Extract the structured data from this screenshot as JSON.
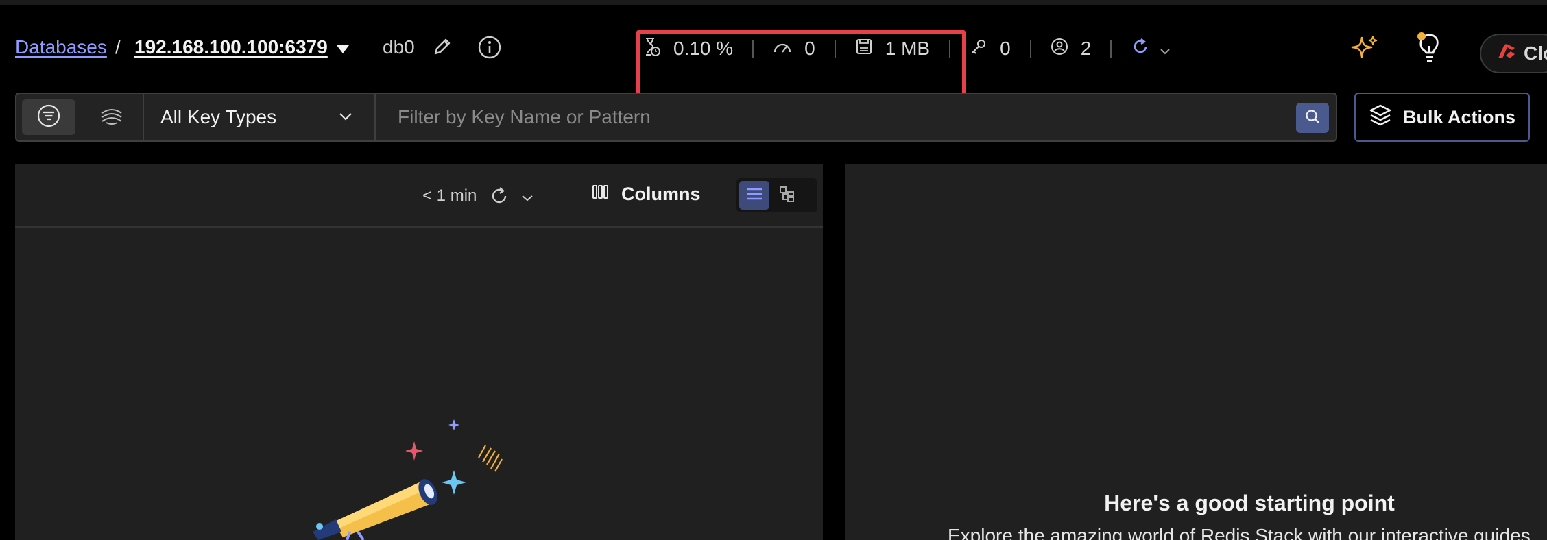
{
  "breadcrumb": {
    "databases_label": "Databases",
    "separator": "/",
    "host": "192.168.100.100:6379",
    "db_label": "db0"
  },
  "stats": {
    "cpu": "0.10 %",
    "ops": "0",
    "memory": "1 MB",
    "keys": "0",
    "clients": "2"
  },
  "header_actions": {
    "cloud_label": "Clo"
  },
  "filter": {
    "key_type_selected": "All Key Types",
    "search_placeholder": "Filter by Key Name or Pattern",
    "search_value": ""
  },
  "bulk_actions_label": "Bulk Actions",
  "list_header": {
    "last_refresh": "< 1 min",
    "columns_label": "Columns"
  },
  "right_panel": {
    "title": "Here's a good starting point",
    "subtitle": "Explore the amazing world of Redis Stack with our interactive guides"
  },
  "colors": {
    "accent": "#8f9bff",
    "highlight": "#e8404b",
    "redis_red": "#e8403a",
    "star_gold": "#f2b13a",
    "sparkle_pink": "#e8566a",
    "sparkle_blue": "#6cc6f0"
  },
  "icons": [
    "timer-icon",
    "gauge-icon",
    "memory-icon",
    "key-icon",
    "user-icon",
    "refresh-icon",
    "ai-sparkle-icon",
    "lightbulb-icon",
    "filter-icon",
    "stack-icon",
    "search-icon",
    "layers-icon",
    "columns-icon",
    "list-view-icon",
    "tree-view-icon",
    "telescope-illustration"
  ]
}
